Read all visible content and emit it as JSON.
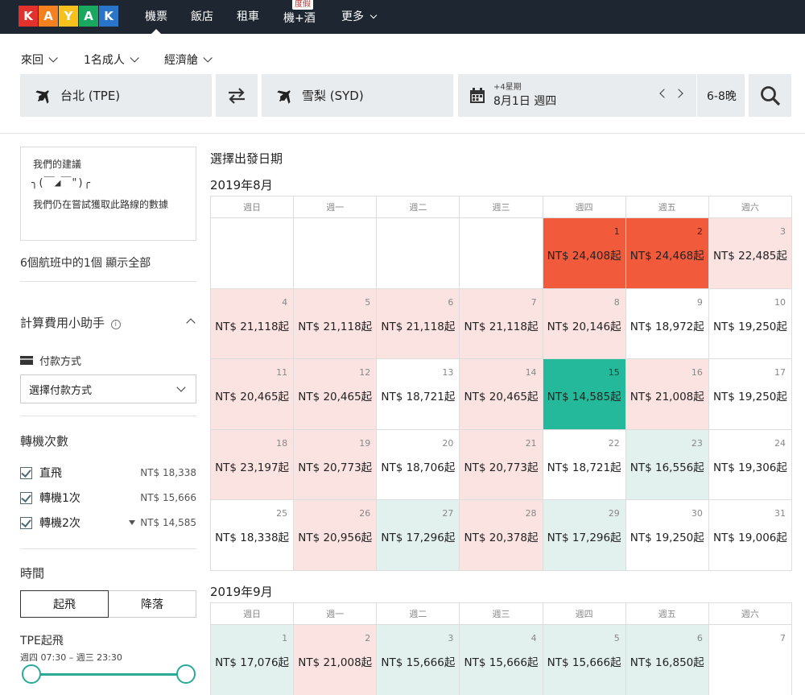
{
  "nav": {
    "logo": [
      "K",
      "A",
      "Y",
      "A",
      "K"
    ],
    "logo_colors": [
      "#e2322b",
      "#f58020",
      "#f6c11d",
      "#1aa860",
      "#2a74c9"
    ],
    "items": [
      "機票",
      "飯店",
      "租車",
      "機+酒",
      "更多"
    ],
    "badge": "度假"
  },
  "search": {
    "trip_type": "來回",
    "travelers": "1名成人",
    "cabin": "經濟艙",
    "origin": "台北 (TPE)",
    "destination": "雪梨 (SYD)",
    "date_hint": "+4星期",
    "date": "8月1日 週四",
    "duration": "6-8晚"
  },
  "sidebar": {
    "suggest_title": "我們的建議",
    "suggest_face": "╮(￣◢￣\")╭",
    "suggest_msg": "我們仍在嘗試獲取此路線的數據",
    "flights_count": "6個航班中的1個",
    "show_all": "顯示全部",
    "fee_title": "計算費用小助手",
    "payment_label": "付款方式",
    "payment_select": "選擇付款方式",
    "stops_title": "轉機次數",
    "stops": [
      {
        "label": "直飛",
        "price": "NT$ 18,338"
      },
      {
        "label": "轉機1次",
        "price": "NT$ 15,666"
      },
      {
        "label": "轉機2次",
        "price": "NT$ 14,585"
      }
    ],
    "time_title": "時間",
    "tab_depart": "起飛",
    "tab_arrive": "降落",
    "tpe_label": "TPE起飛",
    "tpe_range": "週四 07:30 – 週三 23:30"
  },
  "calendar": {
    "title": "選擇出發日期",
    "weekdays": [
      "週日",
      "週一",
      "週二",
      "週三",
      "週四",
      "週五",
      "週六"
    ],
    "months": [
      {
        "name": "2019年8月",
        "cells": [
          {
            "d": "",
            "p": "",
            "c": ""
          },
          {
            "d": "",
            "p": "",
            "c": ""
          },
          {
            "d": "",
            "p": "",
            "c": ""
          },
          {
            "d": "",
            "p": "",
            "c": ""
          },
          {
            "d": "1",
            "p": "NT$ 24,408起",
            "c": "red"
          },
          {
            "d": "2",
            "p": "NT$ 24,468起",
            "c": "red"
          },
          {
            "d": "3",
            "p": "NT$ 22,485起",
            "c": "pink"
          },
          {
            "d": "4",
            "p": "NT$ 21,118起",
            "c": "pink"
          },
          {
            "d": "5",
            "p": "NT$ 21,118起",
            "c": "pink"
          },
          {
            "d": "6",
            "p": "NT$ 21,118起",
            "c": "pink"
          },
          {
            "d": "7",
            "p": "NT$ 21,118起",
            "c": "pink"
          },
          {
            "d": "8",
            "p": "NT$ 20,146起",
            "c": "pink"
          },
          {
            "d": "9",
            "p": "NT$ 18,972起",
            "c": ""
          },
          {
            "d": "10",
            "p": "NT$ 19,250起",
            "c": ""
          },
          {
            "d": "11",
            "p": "NT$ 20,465起",
            "c": "pink"
          },
          {
            "d": "12",
            "p": "NT$ 20,465起",
            "c": "pink"
          },
          {
            "d": "13",
            "p": "NT$ 18,721起",
            "c": ""
          },
          {
            "d": "14",
            "p": "NT$ 20,465起",
            "c": "pink"
          },
          {
            "d": "15",
            "p": "NT$ 14,585起",
            "c": "teal"
          },
          {
            "d": "16",
            "p": "NT$ 21,008起",
            "c": "pink"
          },
          {
            "d": "17",
            "p": "NT$ 19,250起",
            "c": ""
          },
          {
            "d": "18",
            "p": "NT$ 23,197起",
            "c": "pink"
          },
          {
            "d": "19",
            "p": "NT$ 20,773起",
            "c": "pink"
          },
          {
            "d": "20",
            "p": "NT$ 18,706起",
            "c": ""
          },
          {
            "d": "21",
            "p": "NT$ 20,773起",
            "c": "pink"
          },
          {
            "d": "22",
            "p": "NT$ 18,721起",
            "c": ""
          },
          {
            "d": "23",
            "p": "NT$ 16,556起",
            "c": "mint"
          },
          {
            "d": "24",
            "p": "NT$ 19,306起",
            "c": ""
          },
          {
            "d": "25",
            "p": "NT$ 18,338起",
            "c": ""
          },
          {
            "d": "26",
            "p": "NT$ 20,956起",
            "c": "pink"
          },
          {
            "d": "27",
            "p": "NT$ 17,296起",
            "c": "mint"
          },
          {
            "d": "28",
            "p": "NT$ 20,378起",
            "c": "pink"
          },
          {
            "d": "29",
            "p": "NT$ 17,296起",
            "c": "mint"
          },
          {
            "d": "30",
            "p": "NT$ 19,250起",
            "c": ""
          },
          {
            "d": "31",
            "p": "NT$ 19,006起",
            "c": ""
          }
        ]
      },
      {
        "name": "2019年9月",
        "cells": [
          {
            "d": "1",
            "p": "NT$ 17,076起",
            "c": "mint"
          },
          {
            "d": "2",
            "p": "NT$ 21,008起",
            "c": "pink"
          },
          {
            "d": "3",
            "p": "NT$ 15,666起",
            "c": "mint"
          },
          {
            "d": "4",
            "p": "NT$ 15,666起",
            "c": "mint"
          },
          {
            "d": "5",
            "p": "NT$ 15,666起",
            "c": "mint"
          },
          {
            "d": "6",
            "p": "NT$ 16,850起",
            "c": "mint"
          },
          {
            "d": "7",
            "p": "",
            "c": ""
          }
        ]
      }
    ]
  }
}
